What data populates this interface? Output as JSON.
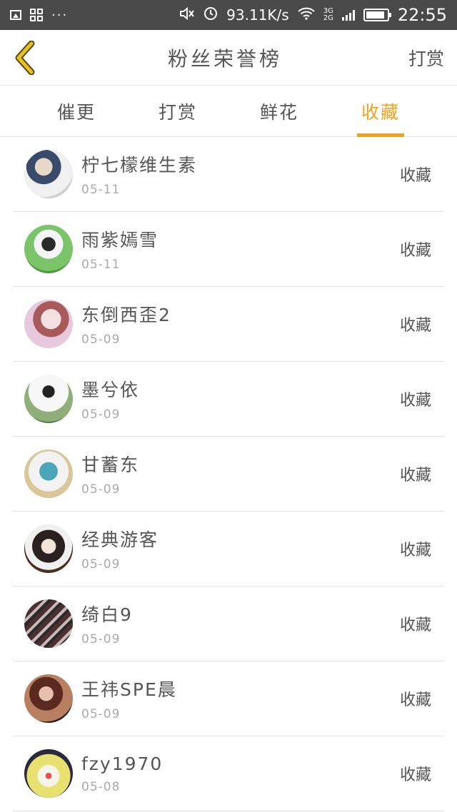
{
  "status_bar": {
    "speed": "93.11K/s",
    "net_top": "3G",
    "net_bottom": "2G",
    "time": "22:55"
  },
  "header": {
    "title": "粉丝荣誉榜",
    "action": "打赏"
  },
  "tabs": [
    {
      "label": "催更"
    },
    {
      "label": "打赏"
    },
    {
      "label": "鲜花"
    },
    {
      "label": "收藏",
      "active": true
    }
  ],
  "list": [
    {
      "name": "柠七檬维生素",
      "date": "05-11",
      "action": "收藏"
    },
    {
      "name": "雨紫嫣雪",
      "date": "05-11",
      "action": "收藏"
    },
    {
      "name": "东倒西歪2",
      "date": "05-09",
      "action": "收藏"
    },
    {
      "name": "墨兮依",
      "date": "05-09",
      "action": "收藏"
    },
    {
      "name": "甘蓄东",
      "date": "05-09",
      "action": "收藏"
    },
    {
      "name": "经典游客",
      "date": "05-09",
      "action": "收藏"
    },
    {
      "name": "绮白9",
      "date": "05-09",
      "action": "收藏"
    },
    {
      "name": "王祎SPE晨",
      "date": "05-09",
      "action": "收藏"
    },
    {
      "name": "fzy1970",
      "date": "05-08",
      "action": "收藏"
    }
  ],
  "colors": {
    "accent": "#f0a21c",
    "status_bar": "#4a4a4a",
    "text": "#555555",
    "muted": "#aaaaaa",
    "back_arrow": "#e8c020"
  }
}
